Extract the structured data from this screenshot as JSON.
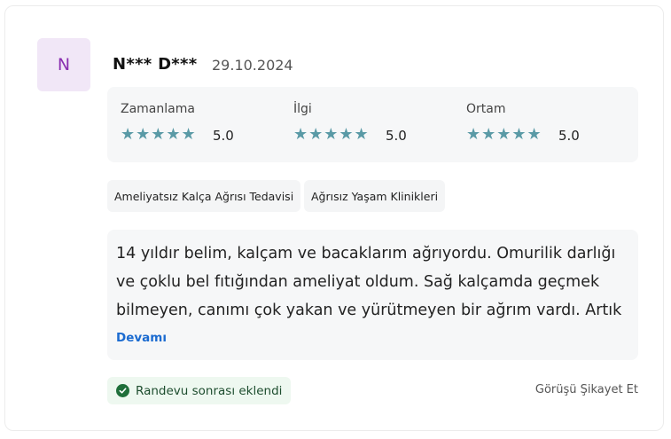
{
  "review": {
    "avatar_initial": "N",
    "author": "N*** D***",
    "date": "29.10.2024",
    "ratings": [
      {
        "label": "Zamanlama",
        "stars": "★★★★★",
        "score": "5.0"
      },
      {
        "label": "İlgi",
        "stars": "★★★★★",
        "score": "5.0"
      },
      {
        "label": "Ortam",
        "stars": "★★★★★",
        "score": "5.0"
      }
    ],
    "tags": [
      "Ameliyatsız Kalça Ağrısı Tedavisi",
      "Ağrısız Yaşam Klinikleri"
    ],
    "text": "14 yıldır belim, kalçam ve bacaklarım ağrıyordu. Omurilik darlığı ve çoklu bel fıtığından ameliyat oldum. Sağ kalçamda geçmek bilmeyen, canımı çok yakan ve yürütmeyen bir ağrım vardı. Artık",
    "more_label": "Devamı",
    "status_label": "Randevu sonrası eklendi",
    "complaint_label": "Görüşü Şikayet Et"
  },
  "colors": {
    "star": "#5a9aa6",
    "avatar_bg": "#f1e7f7",
    "avatar_text": "#8a2fb0",
    "link": "#1b6bd0",
    "status_bg": "#eef8f0",
    "status_icon": "#1f6f3a"
  }
}
